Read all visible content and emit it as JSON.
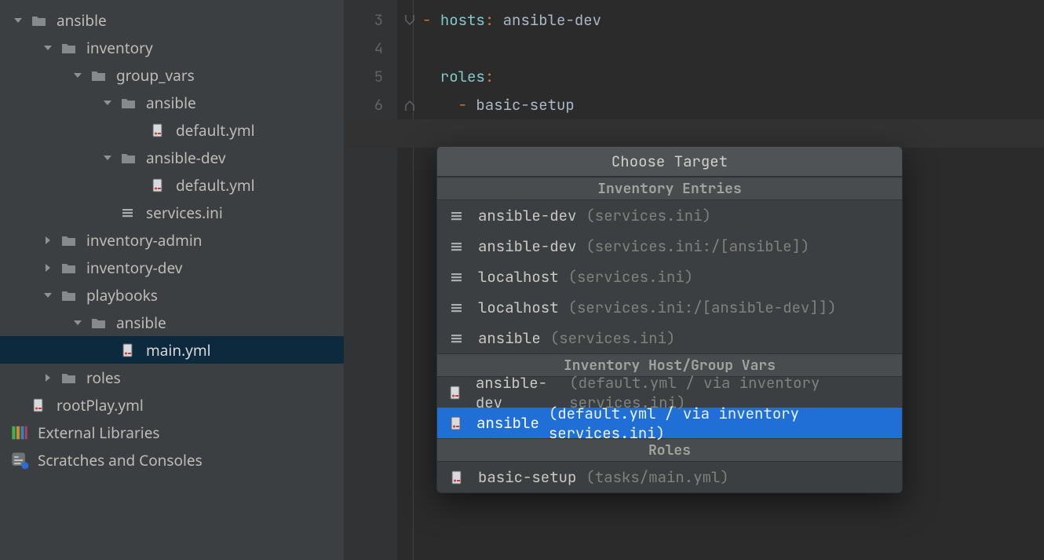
{
  "project": {
    "tree": [
      {
        "depth": 0,
        "chev": "down",
        "icon": "folder",
        "label": "ansible"
      },
      {
        "depth": 1,
        "chev": "down",
        "icon": "folder",
        "label": "inventory"
      },
      {
        "depth": 2,
        "chev": "down",
        "icon": "folder",
        "label": "group_vars"
      },
      {
        "depth": 3,
        "chev": "down",
        "icon": "folder",
        "label": "ansible"
      },
      {
        "depth": 4,
        "chev": "none",
        "icon": "yaml",
        "label": "default.yml"
      },
      {
        "depth": 3,
        "chev": "down",
        "icon": "folder",
        "label": "ansible-dev"
      },
      {
        "depth": 4,
        "chev": "none",
        "icon": "yaml",
        "label": "default.yml"
      },
      {
        "depth": 3,
        "chev": "none",
        "icon": "ini",
        "label": "services.ini"
      },
      {
        "depth": 1,
        "chev": "right",
        "icon": "folder",
        "label": "inventory-admin"
      },
      {
        "depth": 1,
        "chev": "right",
        "icon": "folder",
        "label": "inventory-dev"
      },
      {
        "depth": 1,
        "chev": "down",
        "icon": "folder",
        "label": "playbooks"
      },
      {
        "depth": 2,
        "chev": "down",
        "icon": "folder",
        "label": "ansible"
      },
      {
        "depth": 3,
        "chev": "none",
        "icon": "yaml",
        "label": "main.yml",
        "selected": true
      },
      {
        "depth": 1,
        "chev": "right",
        "icon": "folder",
        "label": "roles"
      },
      {
        "depth": 0,
        "chev": "none",
        "icon": "yaml",
        "label": "rootPlay.yml"
      }
    ],
    "external_libraries": "External Libraries",
    "scratches": "Scratches and Consoles"
  },
  "editor": {
    "first_line_no": 3,
    "lines": [
      {
        "segments": [
          {
            "t": "- ",
            "c": "kw"
          },
          {
            "t": "hosts",
            "c": "id"
          },
          {
            "t": ": ",
            "c": "kw"
          },
          {
            "t": "ansible-dev",
            "c": ""
          }
        ]
      },
      {
        "segments": []
      },
      {
        "segments": [
          {
            "t": "  ",
            "c": ""
          },
          {
            "t": "roles",
            "c": "id"
          },
          {
            "t": ":",
            "c": "kw"
          }
        ]
      },
      {
        "segments": [
          {
            "t": "    - ",
            "c": "kw"
          },
          {
            "t": "basic-setup",
            "c": ""
          }
        ]
      },
      {
        "segments": []
      }
    ]
  },
  "popup": {
    "title": "Choose Target",
    "sections": [
      {
        "heading": "Inventory Entries",
        "items": [
          {
            "icon": "ini",
            "label": "ansible-dev",
            "meta": "(services.ini)"
          },
          {
            "icon": "ini",
            "label": "ansible-dev",
            "meta": "(services.ini:/[ansible])"
          },
          {
            "icon": "ini",
            "label": "localhost",
            "meta": "(services.ini)"
          },
          {
            "icon": "ini",
            "label": "localhost",
            "meta": "(services.ini:/[ansible-dev]])"
          },
          {
            "icon": "ini",
            "label": "ansible",
            "meta": "(services.ini)"
          }
        ]
      },
      {
        "heading": "Inventory Host/Group Vars",
        "items": [
          {
            "icon": "yaml",
            "label": "ansible-dev",
            "meta": "(default.yml / via inventory services.ini)"
          },
          {
            "icon": "yaml",
            "label": "ansible",
            "meta": "(default.yml / via inventory services.ini)",
            "selected": true
          }
        ]
      },
      {
        "heading": "Roles",
        "items": [
          {
            "icon": "yaml",
            "label": "basic-setup",
            "meta": "(tasks/main.yml)"
          }
        ]
      }
    ]
  }
}
